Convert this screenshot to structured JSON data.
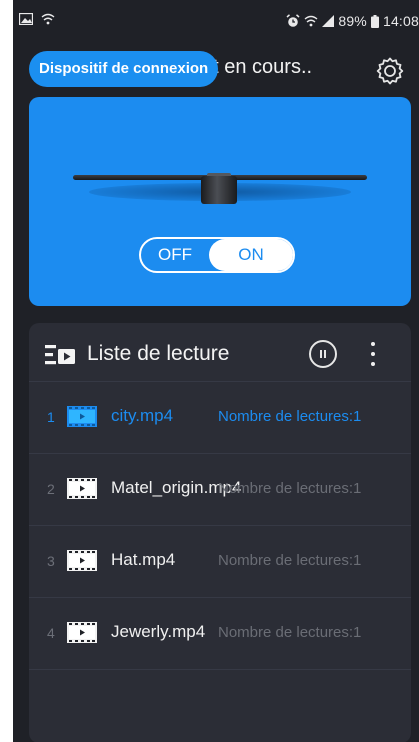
{
  "status_bar": {
    "battery_percent": "89%",
    "time": "14:08",
    "icons_left": [
      "image-icon",
      "wifi-icon"
    ],
    "icons_right": [
      "alarm-icon",
      "wifi-icon",
      "signal-icon",
      "battery-icon"
    ]
  },
  "header": {
    "title": "nt en cours..",
    "pill_label": "Dispositif de connexion",
    "settings_icon": "gear-icon"
  },
  "device": {
    "toggle_off_label": "OFF",
    "toggle_on_label": "ON",
    "state": "ON"
  },
  "playlist": {
    "title": "Liste de lecture",
    "items": [
      {
        "index": "1",
        "name": "city.mp4",
        "count": "Nombre de lectures:1",
        "active": true
      },
      {
        "index": "2",
        "name": "Matel_origin.mp4",
        "count": "Nombre de lectures:1",
        "active": false
      },
      {
        "index": "3",
        "name": "Hat.mp4",
        "count": "Nombre de lectures:1",
        "active": false
      },
      {
        "index": "4",
        "name": "Jewerly.mp4",
        "count": "Nombre de lectures:1",
        "active": false
      }
    ]
  },
  "colors": {
    "accent": "#1c8cf0",
    "background": "#1f2127",
    "panel": "#2b2d36"
  }
}
